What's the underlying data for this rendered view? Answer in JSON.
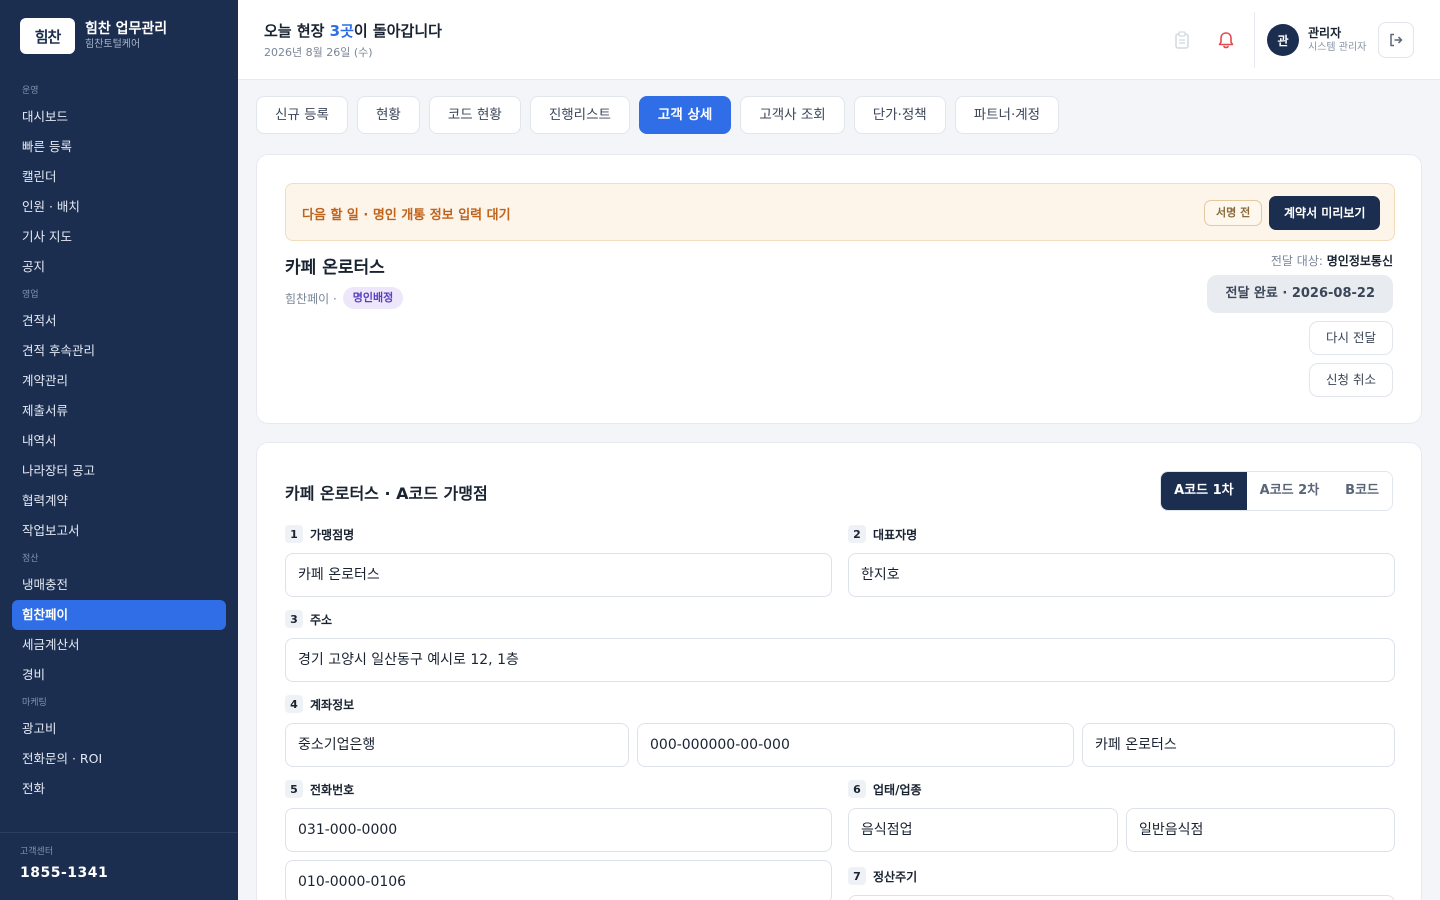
{
  "sidebar": {
    "brand": {
      "logo_text": "힘찬",
      "title": "힘찬 업무관리",
      "subtitle": "힘찬토털케어"
    },
    "sections": [
      {
        "label": "운영",
        "items": [
          "대시보드",
          "빠른 등록",
          "캘린더",
          "인원 · 배치",
          "기사 지도",
          "공지"
        ]
      },
      {
        "label": "영업",
        "items": [
          "견적서",
          "견적 후속관리",
          "계약관리",
          "제출서류",
          "내역서",
          "나라장터 공고",
          "협력계약",
          "작업보고서"
        ]
      },
      {
        "label": "정산",
        "items": [
          "냉매충전",
          "힘찬페이",
          "세금계산서",
          "경비"
        ]
      },
      {
        "label": "마케팅",
        "items": [
          "광고비",
          "전화문의 · ROI",
          "전화"
        ]
      }
    ],
    "active_item": "힘찬페이",
    "support": {
      "label": "고객센터",
      "phone": "1855-1341"
    }
  },
  "header": {
    "greeting_pre": "오늘 현장 ",
    "greeting_num": "3곳",
    "greeting_post": "이 돌아갑니다",
    "date": "2026년 8월 26일 (수)",
    "user": {
      "avatar": "관",
      "name": "관리자",
      "role": "시스템 관리자"
    }
  },
  "tabs": [
    "신규 등록",
    "현황",
    "코드 현황",
    "진행리스트",
    "고객 상세",
    "고객사 조회",
    "단가·정책",
    "파트너·계정"
  ],
  "active_tab": "고객 상세",
  "status_card": {
    "alert_text": "다음 할 일 · 명인 개통 정보 입력 대기",
    "sign_badge": "서명 전",
    "preview_button": "계약서 미리보기",
    "customer_name": "카페 온로터스",
    "meta_company": "힘찬페이 ·",
    "meta_pill": "명인배정",
    "delivery_label": "전달 대상:",
    "delivery_target": "명인정보통신",
    "delivery_done": "전달 완료 · 2026-08-22",
    "resend_button": "다시 전달",
    "cancel_button": "신청 취소"
  },
  "form_card": {
    "title": "카페 온로터스 · A코드 가맹점",
    "segments": [
      "A코드 1차",
      "A코드 2차",
      "B코드"
    ],
    "active_segment": "A코드 1차",
    "fields": {
      "f1": {
        "num": "1",
        "label": "가맹점명",
        "value": "카페 온로터스"
      },
      "f2": {
        "num": "2",
        "label": "대표자명",
        "value": "한지호"
      },
      "f3": {
        "num": "3",
        "label": "주소",
        "value": "경기 고양시 일산동구 예시로 12, 1층"
      },
      "f4": {
        "num": "4",
        "label": "계좌정보",
        "bank": "중소기업은행",
        "account": "000-000000-00-000",
        "holder": "카페 온로터스"
      },
      "f5": {
        "num": "5",
        "label": "전화번호",
        "phone1": "031-000-0000",
        "phone2": "010-0000-0106"
      },
      "f6": {
        "num": "6",
        "label": "업태/업종",
        "type": "음식점업",
        "category": "일반음식점"
      },
      "f7": {
        "num": "7",
        "label": "정산주기"
      }
    }
  },
  "colors": {
    "navy": "#1c2e50",
    "accent": "#2f6ee6",
    "warning": "#c0631b",
    "purple_pill": "#5a3fc0"
  },
  "icons": {
    "clipboard": "clipboard-icon",
    "bell": "bell-icon",
    "logout": "logout-icon"
  }
}
